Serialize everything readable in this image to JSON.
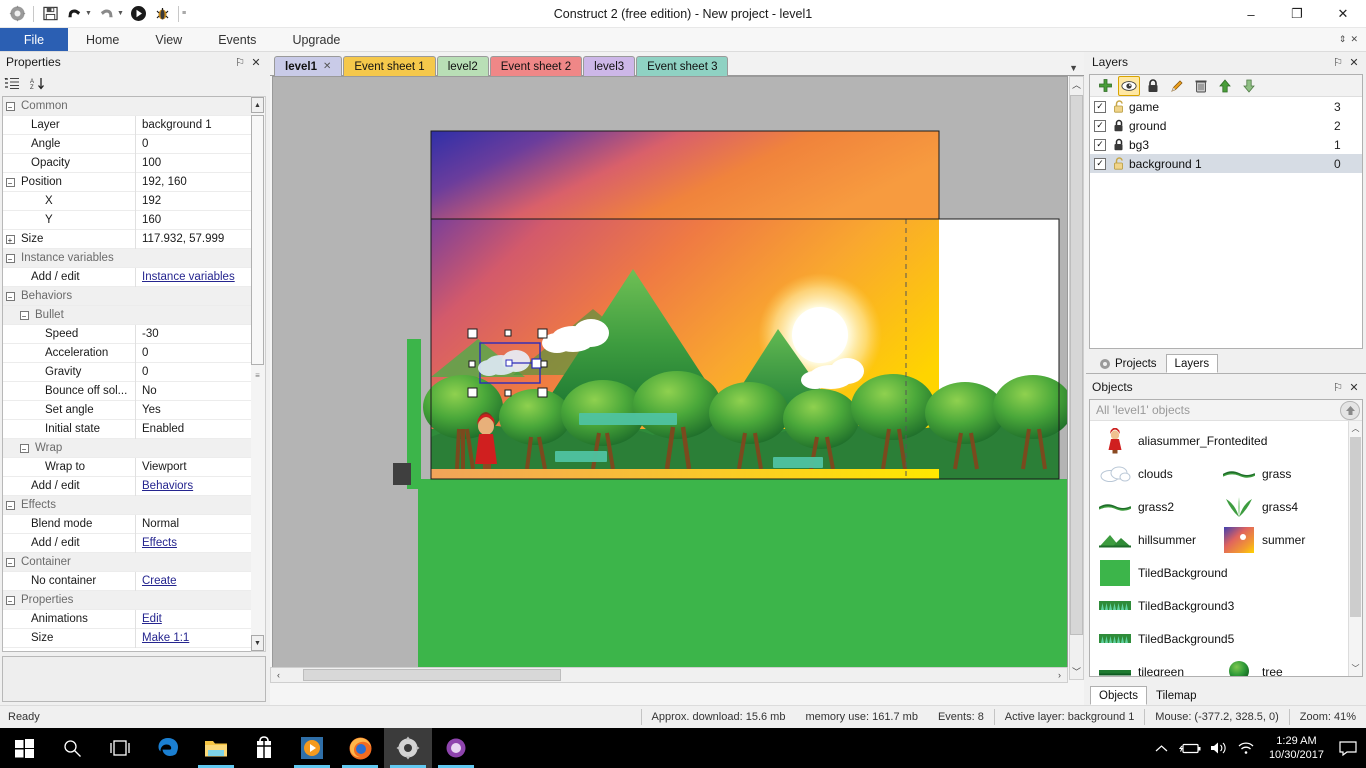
{
  "window": {
    "title": "Construct 2  (free edition) - New project - level1",
    "minimize": "–",
    "maximize": "❐",
    "close": "✕"
  },
  "quick_access": {
    "save": "save-icon",
    "undo": "undo-icon",
    "redo": "redo-icon",
    "run": "run-icon",
    "debug": "debug-icon",
    "more": "≡"
  },
  "ribbon": {
    "tabs": [
      {
        "label": "File",
        "active": true
      },
      {
        "label": "Home",
        "active": false
      },
      {
        "label": "View",
        "active": false
      },
      {
        "label": "Events",
        "active": false
      },
      {
        "label": "Upgrade",
        "active": false
      }
    ]
  },
  "properties": {
    "title": "Properties",
    "pin": "⚐",
    "close": "✕",
    "toolbar": {
      "categorize": "categorize-icon",
      "sort_az": "sort-alpha-icon"
    },
    "rows": [
      {
        "kind": "cat",
        "expander": "−",
        "name": "Common",
        "value": ""
      },
      {
        "kind": "prop",
        "indent": 1,
        "name": "Layer",
        "value": "background 1"
      },
      {
        "kind": "prop",
        "indent": 1,
        "name": "Angle",
        "value": "0"
      },
      {
        "kind": "prop",
        "indent": 1,
        "name": "Opacity",
        "value": "100"
      },
      {
        "kind": "group",
        "expander": "−",
        "indent": 1,
        "name": "Position",
        "value": "192, 160"
      },
      {
        "kind": "prop",
        "indent": 2,
        "name": "X",
        "value": "192"
      },
      {
        "kind": "prop",
        "indent": 2,
        "name": "Y",
        "value": "160"
      },
      {
        "kind": "group",
        "expander": "+",
        "indent": 1,
        "name": "Size",
        "value": "117.932, 57.999"
      },
      {
        "kind": "cat",
        "expander": "−",
        "name": "Instance variables",
        "value": ""
      },
      {
        "kind": "prop",
        "indent": 1,
        "name": "Add / edit",
        "value": "Instance variables",
        "link": true
      },
      {
        "kind": "cat",
        "expander": "−",
        "name": "Behaviors",
        "value": ""
      },
      {
        "kind": "sub",
        "expander": "−",
        "indent": 1,
        "name": "Bullet",
        "value": ""
      },
      {
        "kind": "prop",
        "indent": 2,
        "name": "Speed",
        "value": "-30"
      },
      {
        "kind": "prop",
        "indent": 2,
        "name": "Acceleration",
        "value": "0"
      },
      {
        "kind": "prop",
        "indent": 2,
        "name": "Gravity",
        "value": "0"
      },
      {
        "kind": "prop",
        "indent": 2,
        "name": "Bounce off sol...",
        "value": "No"
      },
      {
        "kind": "prop",
        "indent": 2,
        "name": "Set angle",
        "value": "Yes"
      },
      {
        "kind": "prop",
        "indent": 2,
        "name": "Initial state",
        "value": "Enabled"
      },
      {
        "kind": "sub",
        "expander": "−",
        "indent": 1,
        "name": "Wrap",
        "value": ""
      },
      {
        "kind": "prop",
        "indent": 2,
        "name": "Wrap to",
        "value": "Viewport"
      },
      {
        "kind": "prop",
        "indent": 1,
        "name": "Add / edit",
        "value": "Behaviors",
        "link": true
      },
      {
        "kind": "cat",
        "expander": "−",
        "name": "Effects",
        "value": ""
      },
      {
        "kind": "prop",
        "indent": 1,
        "name": "Blend mode",
        "value": "Normal"
      },
      {
        "kind": "prop",
        "indent": 1,
        "name": "Add / edit",
        "value": "Effects",
        "link": true
      },
      {
        "kind": "cat",
        "expander": "−",
        "name": "Container",
        "value": ""
      },
      {
        "kind": "prop",
        "indent": 1,
        "name": "No container",
        "value": "Create",
        "link": true
      },
      {
        "kind": "cat",
        "expander": "−",
        "name": "Properties",
        "value": ""
      },
      {
        "kind": "prop",
        "indent": 1,
        "name": "Animations",
        "value": "Edit",
        "link": true
      },
      {
        "kind": "prop",
        "indent": 1,
        "name": "Size",
        "value": "Make 1:1",
        "link": true
      }
    ]
  },
  "editor_tabs": [
    {
      "label": "level1",
      "color": "#c9cbe8",
      "active": true,
      "closable": true
    },
    {
      "label": "Event sheet 1",
      "color": "#f5c84b",
      "active": false,
      "closable": false
    },
    {
      "label": "level2",
      "color": "#b9dfb6",
      "active": false,
      "closable": false
    },
    {
      "label": "Event sheet 2",
      "color": "#ef8787",
      "active": false,
      "closable": false
    },
    {
      "label": "level3",
      "color": "#cdb7e8",
      "active": false,
      "closable": false
    },
    {
      "label": "Event sheet 3",
      "color": "#8fd2c3",
      "active": false,
      "closable": false
    }
  ],
  "layers": {
    "title": "Layers",
    "pin": "⚐",
    "close": "✕",
    "toolbar": [
      {
        "name": "add-layer-icon",
        "active": false
      },
      {
        "name": "visibility-icon",
        "active": true
      },
      {
        "name": "lock-icon",
        "active": false
      },
      {
        "name": "rename-icon",
        "active": false
      },
      {
        "name": "delete-icon",
        "active": false
      },
      {
        "name": "move-up-icon",
        "active": false
      },
      {
        "name": "move-down-icon",
        "active": false
      }
    ],
    "rows": [
      {
        "name": "game",
        "index": "3",
        "checked": true,
        "locked": false,
        "selected": false
      },
      {
        "name": "ground",
        "index": "2",
        "checked": true,
        "locked": true,
        "selected": false
      },
      {
        "name": "bg3",
        "index": "1",
        "checked": true,
        "locked": true,
        "selected": false
      },
      {
        "name": "background 1",
        "index": "0",
        "checked": true,
        "locked": false,
        "selected": true
      }
    ]
  },
  "panel_tabs": [
    {
      "label": "Projects",
      "active": false
    },
    {
      "label": "Layers",
      "active": true
    }
  ],
  "objects": {
    "title": "Objects",
    "pin": "⚐",
    "close": "✕",
    "search_placeholder": "All 'level1' objects",
    "up_icon": "up-arrow-icon",
    "items": [
      {
        "label": "aliasummer_Frontedited",
        "icon": "character-icon",
        "wide": true
      },
      {
        "label": "clouds",
        "icon": "cloud-icon",
        "wide": false
      },
      {
        "label": "grass",
        "icon": "grass-line-icon",
        "wide": false
      },
      {
        "label": "grass2",
        "icon": "grass-line-icon",
        "wide": false
      },
      {
        "label": "grass4",
        "icon": "grass-tuft-icon",
        "wide": false
      },
      {
        "label": "hillsummer",
        "icon": "hill-icon",
        "wide": false
      },
      {
        "label": "summer",
        "icon": "gradient-icon",
        "wide": false
      },
      {
        "label": "TiledBackground",
        "icon": "green-square-icon",
        "wide": true
      },
      {
        "label": "TiledBackground3",
        "icon": "grass-strip-icon",
        "wide": true
      },
      {
        "label": "TiledBackground5",
        "icon": "grass-strip-icon",
        "wide": true
      },
      {
        "label": "tilegreen",
        "icon": "green-line-icon",
        "wide": false
      },
      {
        "label": "tree",
        "icon": "tree-icon",
        "wide": false
      }
    ],
    "tabs": [
      {
        "label": "Objects",
        "active": true
      },
      {
        "label": "Tilemap",
        "active": false
      }
    ]
  },
  "statusbar": {
    "ready": "Ready",
    "download": "Approx. download: 15.6 mb",
    "memory": "memory use: 161.7 mb",
    "events": "Events: 8",
    "active_layer": "Active layer: background 1",
    "mouse": "Mouse: (-377.2, 328.5, 0)",
    "zoom": "Zoom: 41%"
  },
  "taskbar": {
    "start": "start-icon",
    "search": "search-icon",
    "taskview": "task-view-icon",
    "apps": [
      {
        "name": "edge-icon",
        "running": false,
        "active": false
      },
      {
        "name": "explorer-icon",
        "running": true,
        "active": false
      },
      {
        "name": "store-icon",
        "running": false,
        "active": false
      },
      {
        "name": "media-icon",
        "running": true,
        "active": false
      },
      {
        "name": "firefox-icon",
        "running": true,
        "active": false
      },
      {
        "name": "construct2-icon",
        "running": true,
        "active": true
      },
      {
        "name": "photos-icon",
        "running": true,
        "active": false
      }
    ],
    "tray": [
      {
        "name": "chevron-up-icon"
      },
      {
        "name": "battery-icon"
      },
      {
        "name": "volume-icon"
      },
      {
        "name": "wifi-icon"
      }
    ],
    "time": "1:29 AM",
    "date": "10/30/2017",
    "notifications": "notification-icon"
  },
  "canvas": {
    "selection_label": "clouds-instance-selection",
    "layout_name": "level1"
  },
  "colors": {
    "file_tab": "#2b5fb3",
    "layer_selected": "#d6dce4",
    "link": "#25258f",
    "taskbar": "#000000"
  }
}
